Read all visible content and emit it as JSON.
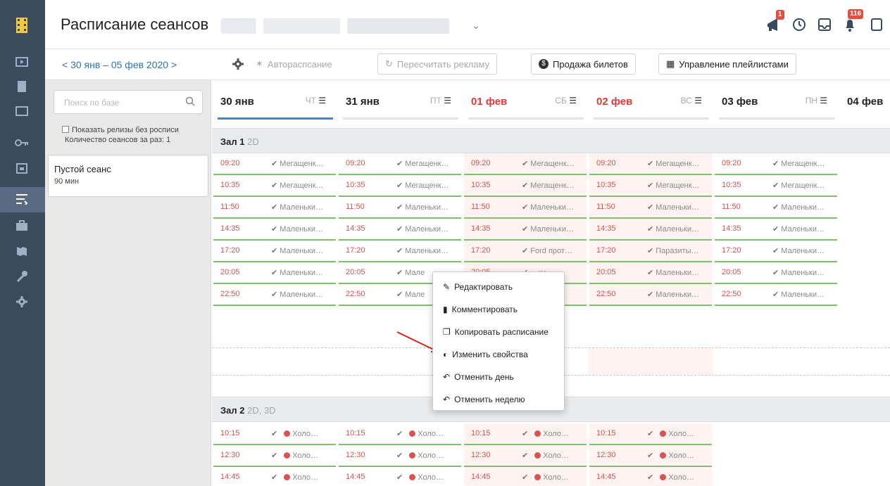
{
  "header": {
    "title": "Расписание сеансов",
    "notifications_badge": "1",
    "alerts_badge": "116"
  },
  "left_panel": {
    "date_range": "< 30 янв – 05 фев 2020 >",
    "search_placeholder": "Поиск по базе",
    "show_releases_label": "Показать релизы без росписи",
    "sessions_count_label": "Количество сеансов за раз: 1",
    "empty_session_title": "Пустой сеанс",
    "empty_session_duration": "90 мин"
  },
  "toolbar": {
    "auto_schedule": "Автораспсание",
    "recalc_ads": "Пересчитать рекламу",
    "ticket_sales": "Продажа билетов",
    "playlists": "Управление плейлистами"
  },
  "days": [
    {
      "date": "30 янв",
      "dow": "ЧТ",
      "weekend": false
    },
    {
      "date": "31 янв",
      "dow": "ПТ",
      "weekend": false
    },
    {
      "date": "01 фев",
      "dow": "СБ",
      "weekend": true
    },
    {
      "date": "02 фев",
      "dow": "ВС",
      "weekend": true
    },
    {
      "date": "03 фев",
      "dow": "ПН",
      "weekend": false
    },
    {
      "date": "04 фев",
      "dow": "",
      "weekend": false
    }
  ],
  "halls": [
    {
      "name": "Зал 1",
      "format": "2D",
      "rows": [
        {
          "time": "09:20",
          "movies": [
            "Мегащенк…",
            "Мегащенк…",
            "Мегащенк…",
            "Мегащенк…",
            "Мегащенк…"
          ]
        },
        {
          "time": "10:35",
          "movies": [
            "Мегащенк…",
            "Мегащенк…",
            "Мегащенк…",
            "Мегащенк…",
            "Мегащенк…"
          ]
        },
        {
          "time": "11:50",
          "movies": [
            "Маленьки…",
            "Маленьки…",
            "Маленьки…",
            "Маленьки…",
            "Маленьки…"
          ]
        },
        {
          "time": "14:35",
          "movies": [
            "Маленьки…",
            "Маленьки…",
            "Маленьки…",
            "Маленьки…",
            "Маленьки…"
          ]
        },
        {
          "time": "17:20",
          "movies": [
            "Маленьки…",
            "Маленьки…",
            "Ford прот…",
            "Паразиты…",
            "Маленьки…"
          ]
        },
        {
          "time": "20:05",
          "movies": [
            "Маленьки…",
            "Мале",
            "…ки…",
            "Маленьки…",
            "Маленьки…"
          ]
        },
        {
          "time": "22:50",
          "movies": [
            "Маленьки…",
            "Мале",
            "…ки…",
            "Маленьки…",
            "Маленьки…"
          ]
        }
      ]
    },
    {
      "name": "Зал 2",
      "format": "2D, 3D",
      "rows": [
        {
          "time": "10:15",
          "movies": [
            "Холо…",
            "Холо…",
            "Холо…",
            "Холо…"
          ]
        },
        {
          "time": "12:30",
          "movies": [
            "Холо…",
            "Холо…",
            "Холо…",
            "Холо…"
          ]
        },
        {
          "time": "14:45",
          "movies": [
            "Холо…",
            "Холо…",
            "Холо…",
            "Холо…"
          ]
        }
      ]
    }
  ],
  "context_menu": [
    "Редактировать",
    "Комментировать",
    "Копировать расписание",
    "Изменить свойства",
    "Отменить день",
    "Отменить неделю"
  ],
  "colors": {
    "sidebar": "#3b4a5c",
    "accent": "#4a84c4",
    "weekend": "#e03a36",
    "session_line": "#7fc06a"
  }
}
